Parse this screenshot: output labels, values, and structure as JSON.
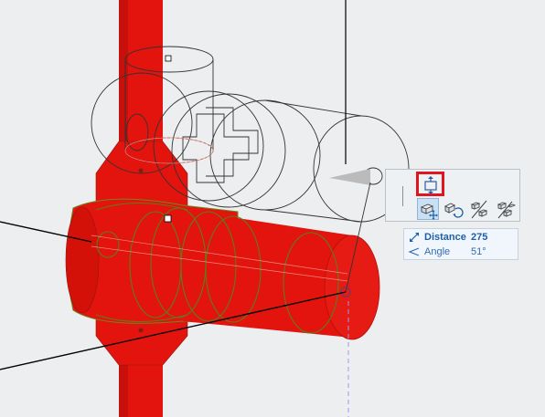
{
  "tracker": {
    "distance_label": "Distance",
    "distance_value": "275",
    "angle_label": "Angle",
    "angle_value": "51°"
  },
  "palette": {
    "tools": [
      "elevation-offset",
      "move",
      "rotate",
      "mirror",
      "multiply"
    ],
    "highlighted_tool": "elevation-offset",
    "active_tool": "move"
  },
  "colors": {
    "pipe_red": "#e3140e",
    "ghost_outline": "#333333",
    "highlight_box": "#e0151d",
    "tracker_text": "#1d5fa8",
    "viewport_bg": "#eceef0"
  }
}
